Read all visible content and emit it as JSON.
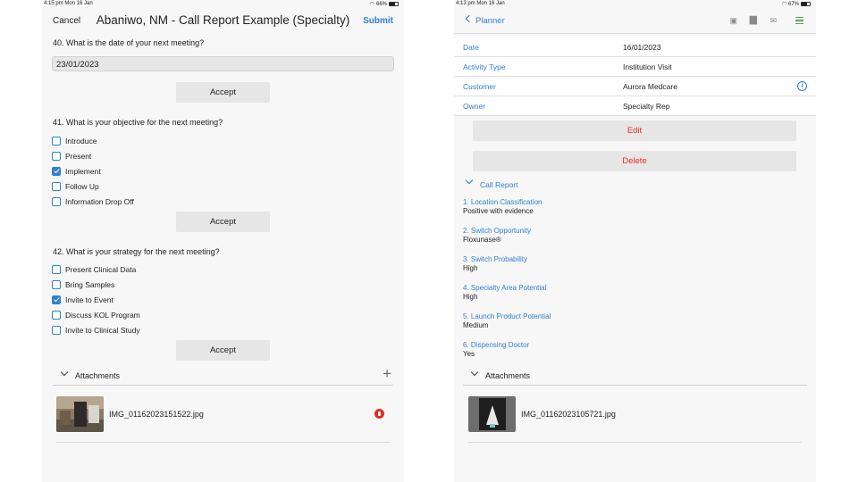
{
  "left": {
    "status": {
      "time": "4:15 pm  Mon 16 Jan",
      "battery": "66%",
      "battery_fill": 0.66
    },
    "nav": {
      "cancel": "Cancel",
      "title": "Abaniwo, NM - Call Report Example (Specialty)",
      "submit": "Submit"
    },
    "q40": {
      "label": "40. What is the date of your next meeting?",
      "value": "23/01/2023",
      "accept": "Accept"
    },
    "q41": {
      "label": "41. What is your objective for the next meeting?",
      "options": [
        {
          "label": "Introduce",
          "checked": false
        },
        {
          "label": "Present",
          "checked": false
        },
        {
          "label": "Implement",
          "checked": true
        },
        {
          "label": "Follow Up",
          "checked": false
        },
        {
          "label": "Information Drop Off",
          "checked": false
        }
      ],
      "accept": "Accept"
    },
    "q42": {
      "label": "42. What is your strategy for the next meeting?",
      "options": [
        {
          "label": "Present Clinical Data",
          "checked": false
        },
        {
          "label": "Bring Samples",
          "checked": false
        },
        {
          "label": "Invite to Event",
          "checked": true
        },
        {
          "label": "Discuss KOL Program",
          "checked": false
        },
        {
          "label": "Invite to Clinical Study",
          "checked": false
        }
      ],
      "accept": "Accept"
    },
    "attachments": {
      "label": "Attachments",
      "add_icon": "plus-icon",
      "file": "IMG_01162023151522.jpg",
      "remove_icon": "remove-icon"
    }
  },
  "right": {
    "status": {
      "time": "4:13 pm  Mon 16 Jan",
      "battery": "67%",
      "battery_fill": 0.67
    },
    "nav": {
      "back": "Planner",
      "icons": [
        "calendar-icon",
        "chart-icon",
        "mail-icon",
        "menu-icon"
      ]
    },
    "details": [
      {
        "key": "Date",
        "value": "16/01/2023"
      },
      {
        "key": "Activity Type",
        "value": "Institution Visit"
      },
      {
        "key": "Customer",
        "value": "Aurora Medcare",
        "info": true
      },
      {
        "key": "Owner",
        "value": "Specialty Rep"
      }
    ],
    "edit": "Edit",
    "delete": "Delete",
    "call_report": {
      "label": "Call Report",
      "items": [
        {
          "q": "1. Location Classification",
          "a": "Positive with evidence"
        },
        {
          "q": "2. Switch Opportunity",
          "a": "Floxunase®"
        },
        {
          "q": "3. Switch Probability",
          "a": "High"
        },
        {
          "q": "4. Specialty Area Potential",
          "a": "High"
        },
        {
          "q": "5. Launch Product Potential",
          "a": "Medium"
        },
        {
          "q": "6. Dispensing Doctor",
          "a": "Yes"
        }
      ]
    },
    "attachments": {
      "label": "Attachments",
      "file": "IMG_01162023105721.jpg"
    }
  },
  "colors": {
    "accent": "#2f80d1",
    "danger": "#e0301e",
    "menu": "#4caf50"
  }
}
